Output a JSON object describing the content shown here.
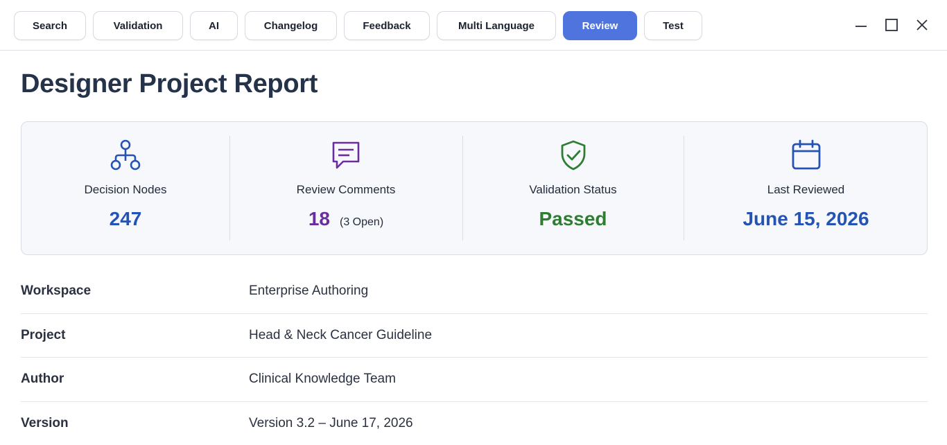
{
  "tabs": [
    {
      "label": "Search"
    },
    {
      "label": "Validation"
    },
    {
      "label": "AI"
    },
    {
      "label": "Changelog"
    },
    {
      "label": "Feedback"
    },
    {
      "label": "Multi Language"
    },
    {
      "label": "Review",
      "active": true
    },
    {
      "label": "Test"
    }
  ],
  "page": {
    "title": "Designer Project Report"
  },
  "stats": {
    "nodes": {
      "label": "Decision Nodes",
      "value": "247",
      "icon": "hierarchy-icon",
      "color": "#2553b3"
    },
    "comments": {
      "label": "Review Comments",
      "value": "18",
      "sub": "(3 Open)",
      "icon": "comment-icon",
      "color": "#6a2d9e"
    },
    "validation": {
      "label": "Validation Status",
      "value": "Passed",
      "icon": "shield-check-icon",
      "color": "#2e7d32"
    },
    "reviewed": {
      "label": "Last Reviewed",
      "value": "June 15, 2026",
      "icon": "calendar-icon",
      "color": "#2553b3"
    }
  },
  "details": [
    {
      "key": "Workspace",
      "value": "Enterprise Authoring"
    },
    {
      "key": "Project",
      "value": "Head & Neck Cancer Guideline"
    },
    {
      "key": "Author",
      "value": "Clinical Knowledge Team"
    },
    {
      "key": "Version",
      "value": "Version 3.2 – June 17, 2026"
    }
  ],
  "colors": {
    "accent": "#4f74de"
  }
}
